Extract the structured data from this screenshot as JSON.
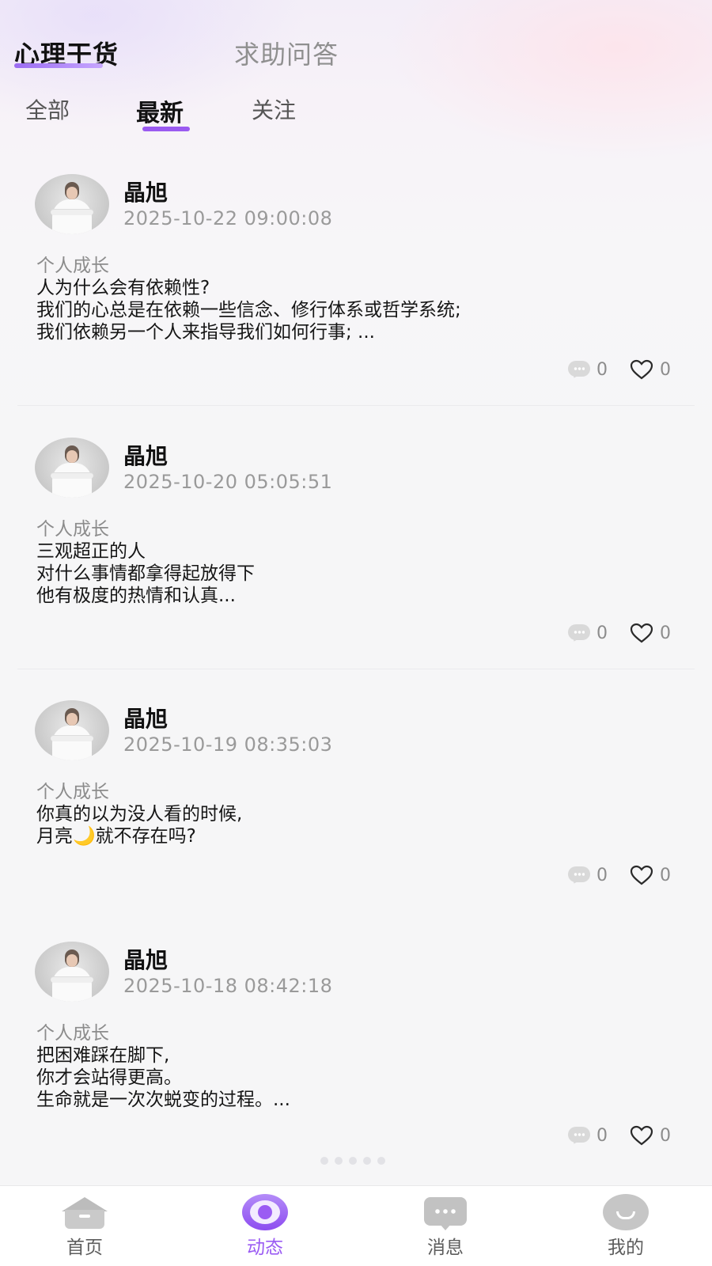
{
  "primary_tabs": [
    {
      "label": "心理干货",
      "active": true
    },
    {
      "label": "求助问答",
      "active": false
    }
  ],
  "sub_tabs": [
    {
      "label": "全部",
      "active": false
    },
    {
      "label": "最新",
      "active": true
    },
    {
      "label": "关注",
      "active": false
    }
  ],
  "posts": [
    {
      "author": "晶旭",
      "time": "2025-10-22 09:00:08",
      "category": "个人成长",
      "lines": [
        "人为什么会有依赖性?",
        "我们的心总是在依赖一些信念、修行体系或哲学系统;",
        "我们依赖另一个人来指导我们如何行事; ..."
      ],
      "comments": "0",
      "likes": "0"
    },
    {
      "author": "晶旭",
      "time": "2025-10-20 05:05:51",
      "category": "个人成长",
      "lines": [
        "三观超正的人",
        "对什么事情都拿得起放得下",
        "他有极度的热情和认真..."
      ],
      "comments": "0",
      "likes": "0"
    },
    {
      "author": "晶旭",
      "time": "2025-10-19 08:35:03",
      "category": "个人成长",
      "lines": [
        "你真的以为没人看的时候,",
        "月亮🌙就不存在吗?"
      ],
      "comments": "0",
      "likes": "0"
    },
    {
      "author": "晶旭",
      "time": "2025-10-18 08:42:18",
      "category": "个人成长",
      "lines": [
        "把困难踩在脚下,",
        "你才会站得更高。",
        "生命就是一次次蜕变的过程。..."
      ],
      "comments": "0",
      "likes": "0"
    }
  ],
  "tabbar": [
    {
      "label": "首页",
      "icon": "home-icon",
      "active": false
    },
    {
      "label": "动态",
      "icon": "moments-icon",
      "active": true
    },
    {
      "label": "消息",
      "icon": "message-icon",
      "active": false
    },
    {
      "label": "我的",
      "icon": "profile-icon",
      "active": false
    }
  ],
  "colors": {
    "accent": "#9b5cf3",
    "muted_text": "#9a9a9a",
    "icon_gray": "#c6c6c6"
  }
}
